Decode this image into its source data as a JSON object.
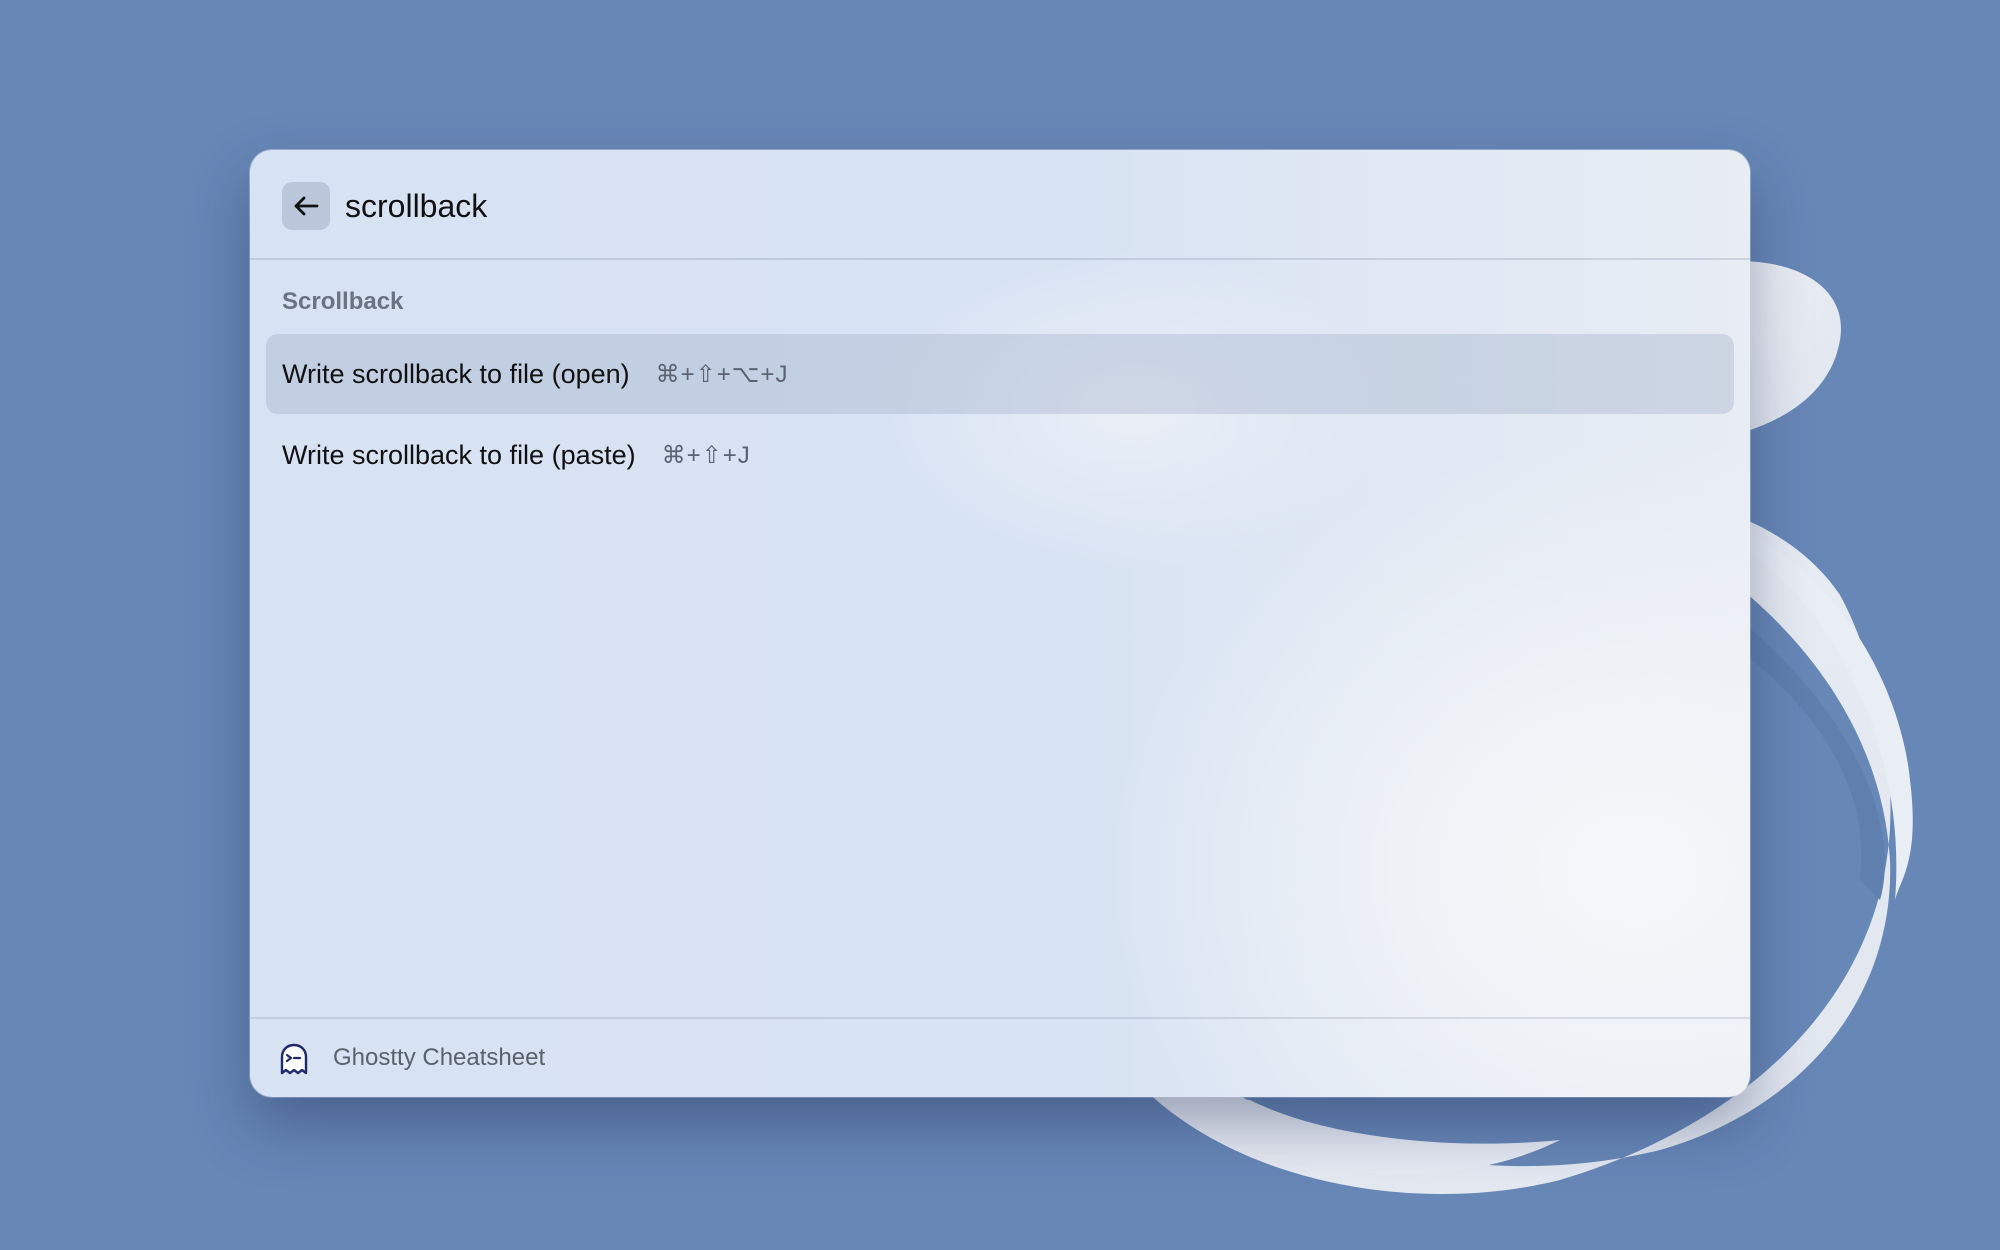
{
  "search": {
    "value": "scrollback",
    "back_icon": "arrow-left-icon"
  },
  "results": {
    "section_title": "Scrollback",
    "items": [
      {
        "label": "Write scrollback to file (open)",
        "shortcut": "⌘+⇧+⌥+J",
        "selected": true
      },
      {
        "label": "Write scrollback to file (paste)",
        "shortcut": "⌘+⇧+J",
        "selected": false
      }
    ]
  },
  "footer": {
    "title": "Ghostty Cheatsheet",
    "icon": "ghostty-ghost-icon"
  },
  "colors": {
    "desktop_background": "#6787b7",
    "panel_background": "#d8e3f3",
    "selection": "#bfcadb",
    "ghost_icon_stroke": "#1f2a6b"
  }
}
